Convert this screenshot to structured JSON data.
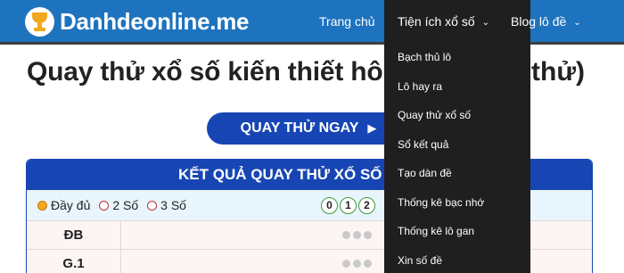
{
  "header": {
    "logo_text": "Danhdeonline.me",
    "nav": {
      "home": "Trang chủ",
      "tienich": "Tiện ích xổ số",
      "blog": "Blog lô đề"
    }
  },
  "dropdown": {
    "items": [
      "Bạch thủ lô",
      "Lô hay ra",
      "Quay thử xổ số",
      "Sổ kết quả",
      "Tạo dàn đề",
      "Thống kê bạc nhớ",
      "Thống kê lô gan",
      "Xin số đề"
    ]
  },
  "main": {
    "title": "Quay thử xổ số kiến thiết hôm",
    "title_tail": "thử)",
    "spin_button": "QUAY THỬ NGAY",
    "results_header": "KẾT QUẢ QUAY THỬ XỔ SỐ M",
    "options": [
      "Đầy đủ",
      "2 Số",
      "3 Số"
    ],
    "digits": [
      "0",
      "1",
      "2"
    ],
    "rows": [
      "ĐB",
      "G.1"
    ]
  },
  "colors": {
    "header_bg": "#1e73be",
    "dropdown_bg": "#1f1f1f",
    "button_bg": "#1746b4",
    "options_bg": "#e8f5fd",
    "row_bg": "#fdf4f4",
    "logo_accent": "#f2a81d"
  }
}
